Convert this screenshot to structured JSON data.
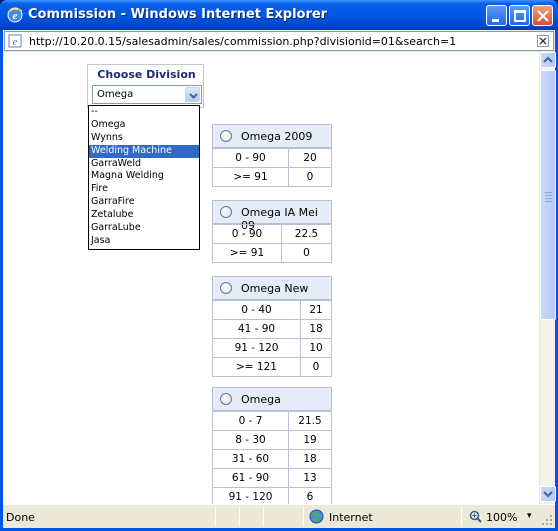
{
  "window": {
    "title": "Commission - Windows Internet Explorer",
    "url": "http://10.20.0.15/salesadmin/sales/commission.php?divisionid=01&search=1"
  },
  "division": {
    "heading": "Choose Division",
    "selected": "Omega",
    "options": [
      "--",
      "Omega",
      "Wynns",
      "Welding Machine",
      "GarraWeld",
      "Magna Welding",
      "Fire",
      "GarraFire",
      "Zetalube",
      "GarraLube",
      "Jasa"
    ],
    "highlighted": "Welding Machine"
  },
  "tables": [
    {
      "name": "Omega 2009",
      "rows": [
        [
          "0 - 90",
          "20"
        ],
        [
          ">= 91",
          "0"
        ]
      ]
    },
    {
      "name": "Omega IA Mei 09",
      "rows": [
        [
          "0 - 90",
          "22.5"
        ],
        [
          ">= 91",
          "0"
        ]
      ]
    },
    {
      "name": "Omega New",
      "rows": [
        [
          "0 - 40",
          "21"
        ],
        [
          "41 - 90",
          "18"
        ],
        [
          "91 - 120",
          "10"
        ],
        [
          ">= 121",
          "0"
        ]
      ]
    },
    {
      "name": "Omega",
      "rows": [
        [
          "0 - 7",
          "21.5"
        ],
        [
          "8 - 30",
          "19"
        ],
        [
          "31 - 60",
          "18"
        ],
        [
          "61 - 90",
          "13"
        ],
        [
          "91 - 120",
          "6"
        ]
      ]
    }
  ],
  "status": {
    "left": "Done",
    "zone": "Internet",
    "zoom": "100%"
  },
  "colors": {
    "titlebar": "#0058e6",
    "header_bg": "#e6ecf7",
    "selection": "#316ac5",
    "division_title": "#1f2a72"
  }
}
